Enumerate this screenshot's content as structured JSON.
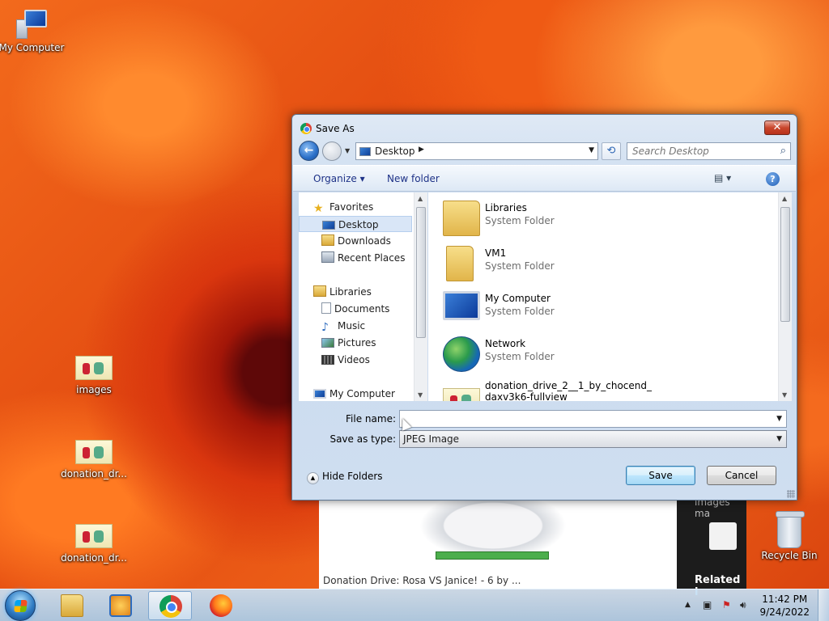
{
  "desktop": {
    "icons": [
      {
        "label": "My Computer"
      },
      {
        "label": "images"
      },
      {
        "label": "donation_dr..."
      },
      {
        "label": "donation_dr..."
      },
      {
        "label": "Recycle Bin"
      }
    ]
  },
  "background_page": {
    "caption": "Donation Drive: Rosa VS Janice! - 6 by ...",
    "side_header": "images ma",
    "side_related": "Related i"
  },
  "dialog": {
    "title": "Save As",
    "close_label": "✕",
    "nav": {
      "back_label": "←",
      "location": "Desktop",
      "location_sep": "▶",
      "refresh_label": "⟲",
      "search_placeholder": "Search Desktop",
      "search_icon": "⌕"
    },
    "toolbar": {
      "organize": "Organize ▾",
      "new_folder": "New folder",
      "view_label": "▤ ▾",
      "help_label": "?"
    },
    "tree": [
      {
        "label": "Favorites",
        "icon": "star-icon"
      },
      {
        "label": "Desktop",
        "icon": "desktop-icon",
        "selected": true
      },
      {
        "label": "Downloads",
        "icon": "downloads-icon"
      },
      {
        "label": "Recent Places",
        "icon": "recent-places-icon"
      },
      {
        "label": "Libraries",
        "icon": "libraries-icon"
      },
      {
        "label": "Documents",
        "icon": "documents-icon"
      },
      {
        "label": "Music",
        "icon": "music-icon"
      },
      {
        "label": "Pictures",
        "icon": "pictures-icon"
      },
      {
        "label": "Videos",
        "icon": "videos-icon"
      },
      {
        "label": "My Computer",
        "icon": "computer-icon"
      }
    ],
    "files": [
      {
        "name": "Libraries",
        "type": "System Folder",
        "icon": "libraries-folder-icon"
      },
      {
        "name": "VM1",
        "type": "System Folder",
        "icon": "user-folder-icon"
      },
      {
        "name": "My Computer",
        "type": "System Folder",
        "icon": "computer-icon"
      },
      {
        "name": "Network",
        "type": "System Folder",
        "icon": "network-icon"
      },
      {
        "name": "donation_drive_2__1_by_chocend_",
        "type": "daxv3k6-fullview",
        "icon": "image-thumbnail-icon"
      }
    ],
    "filename_label": "File name:",
    "filename_value": "",
    "savetype_label": "Save as type:",
    "savetype_value": "JPEG Image",
    "hide_folders": "Hide Folders",
    "save_button": "Save",
    "cancel_button": "Cancel"
  },
  "taskbar": {
    "apps": [
      "windows-explorer",
      "media-player",
      "chrome",
      "firefox"
    ],
    "tray_arrow": "▲",
    "time": "11:42 PM",
    "date": "9/24/2022"
  }
}
